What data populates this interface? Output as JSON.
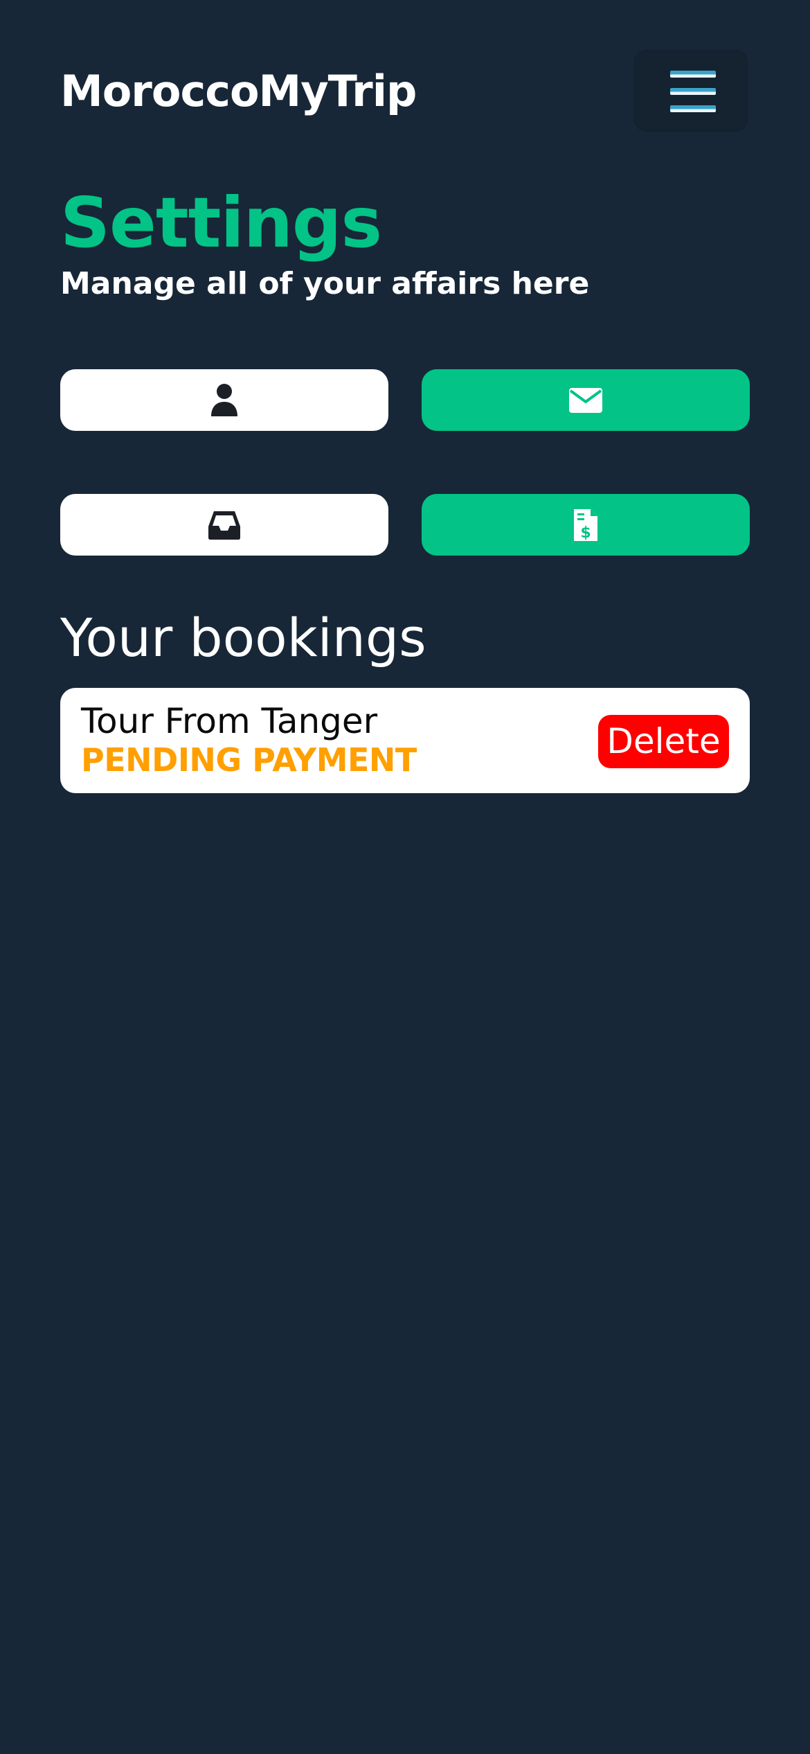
{
  "header": {
    "brand": "MoroccoMyTrip",
    "menu_icon": "hamburger-menu-icon"
  },
  "page": {
    "title": "Settings",
    "subtitle": "Manage all of your affairs here"
  },
  "tiles": [
    {
      "icon": "user-icon",
      "style": "white"
    },
    {
      "icon": "envelope-icon",
      "style": "green"
    },
    {
      "icon": "inbox-icon",
      "style": "white"
    },
    {
      "icon": "invoice-dollar-icon",
      "style": "green"
    }
  ],
  "bookings": {
    "heading": "Your bookings",
    "items": [
      {
        "name": "Tour From Tanger",
        "status": "PENDING PAYMENT",
        "delete_label": "Delete"
      }
    ]
  },
  "colors": {
    "background": "#172737",
    "accent_green": "#03c386",
    "status_pending": "#ff9f00",
    "delete_red": "#ff0000",
    "menu_bar_blue": "#3aa3c7"
  }
}
